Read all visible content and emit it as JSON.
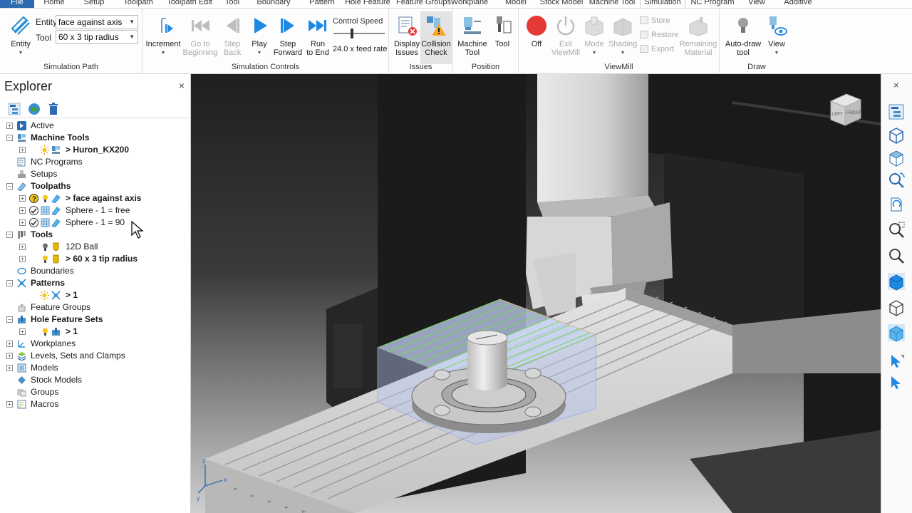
{
  "tabs": [
    "File",
    "Home",
    "Setup",
    "Toolpath",
    "Toolpath Edit",
    "Tool",
    "Boundary",
    "Pattern",
    "Hole Feature",
    "Feature Groups",
    "Workplane",
    "Model",
    "Stock Model",
    "Machine Tool",
    "Simulation",
    "NC Program",
    "View",
    "Additive"
  ],
  "active_tab": "Simulation",
  "ribbon": {
    "simulation_path": {
      "title": "Simulation Path",
      "entity_button": "Entity",
      "entity_label": "Entity",
      "entity_value": "face against axis",
      "tool_label": "Tool",
      "tool_value": "60 x 3 tip radius"
    },
    "simulation_controls": {
      "title": "Simulation Controls",
      "increment": "Increment",
      "go_to_beginning": [
        "Go to",
        "Beginning"
      ],
      "step_back": [
        "Step",
        "Back"
      ],
      "play": "Play",
      "step_forward": [
        "Step",
        "Forward"
      ],
      "run_to_end": [
        "Run",
        "to End"
      ],
      "control_speed": "Control Speed",
      "feed_rate": "24.0 x feed rate"
    },
    "issues": {
      "title": "Issues",
      "display_issues": [
        "Display",
        "Issues"
      ],
      "collision_check": [
        "Collision",
        "Check"
      ]
    },
    "position": {
      "title": "Position",
      "machine_tool": [
        "Machine",
        "Tool"
      ],
      "tool": "Tool"
    },
    "viewmill": {
      "title": "ViewMill",
      "off": "Off",
      "exit_viewmill": [
        "Exit",
        "ViewMill"
      ],
      "mode": "Mode",
      "shading": "Shading",
      "store": "Store",
      "restore": "Restore",
      "export": "Export",
      "remaining_material": [
        "Remaining",
        "Material"
      ]
    },
    "draw": {
      "title": "Draw",
      "auto_draw_tool": [
        "Auto-draw",
        "tool"
      ],
      "view": "View"
    }
  },
  "explorer": {
    "title": "Explorer",
    "close": "×",
    "tree": [
      {
        "label": "Active",
        "bold": false
      },
      {
        "label": "Machine Tools",
        "bold": true
      },
      {
        "label": "> Huron_KX200",
        "bold": true
      },
      {
        "label": "NC Programs",
        "bold": false
      },
      {
        "label": "Setups",
        "bold": false
      },
      {
        "label": "Toolpaths",
        "bold": true
      },
      {
        "label": "> face against axis",
        "bold": true
      },
      {
        "label": "Sphere - 1 = free",
        "bold": false
      },
      {
        "label": "Sphere - 1 = 90",
        "bold": false
      },
      {
        "label": "Tools",
        "bold": true
      },
      {
        "label": "12D Ball",
        "bold": false
      },
      {
        "label": "> 60 x 3 tip radius",
        "bold": true
      },
      {
        "label": "Boundaries",
        "bold": false
      },
      {
        "label": "Patterns",
        "bold": true
      },
      {
        "label": "> 1",
        "bold": true
      },
      {
        "label": "Feature Groups",
        "bold": false
      },
      {
        "label": "Hole Feature Sets",
        "bold": true
      },
      {
        "label": "> 1",
        "bold": true
      },
      {
        "label": "Workplanes",
        "bold": false
      },
      {
        "label": "Levels, Sets and Clamps",
        "bold": false
      },
      {
        "label": "Models",
        "bold": false
      },
      {
        "label": "Stock Models",
        "bold": false
      },
      {
        "label": "Groups",
        "bold": false
      },
      {
        "label": "Macros",
        "bold": false
      }
    ]
  },
  "viewcube": {
    "left": "LEFT",
    "front": "FRONT"
  },
  "right_toolbar": {
    "close": "×"
  },
  "colors": {
    "accent": "#2b6cb0",
    "play_blue": "#1e88e5",
    "off_red": "#e53935",
    "toolpath_green": "#7cd65a"
  }
}
